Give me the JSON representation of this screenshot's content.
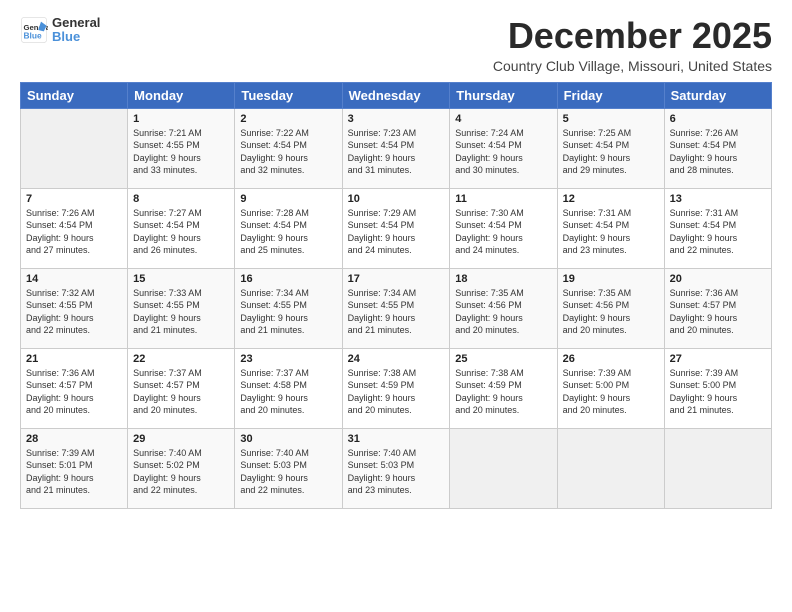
{
  "header": {
    "logo_line1": "General",
    "logo_line2": "Blue",
    "month": "December 2025",
    "location": "Country Club Village, Missouri, United States"
  },
  "weekdays": [
    "Sunday",
    "Monday",
    "Tuesday",
    "Wednesday",
    "Thursday",
    "Friday",
    "Saturday"
  ],
  "weeks": [
    [
      {
        "day": "",
        "info": ""
      },
      {
        "day": "1",
        "info": "Sunrise: 7:21 AM\nSunset: 4:55 PM\nDaylight: 9 hours\nand 33 minutes."
      },
      {
        "day": "2",
        "info": "Sunrise: 7:22 AM\nSunset: 4:54 PM\nDaylight: 9 hours\nand 32 minutes."
      },
      {
        "day": "3",
        "info": "Sunrise: 7:23 AM\nSunset: 4:54 PM\nDaylight: 9 hours\nand 31 minutes."
      },
      {
        "day": "4",
        "info": "Sunrise: 7:24 AM\nSunset: 4:54 PM\nDaylight: 9 hours\nand 30 minutes."
      },
      {
        "day": "5",
        "info": "Sunrise: 7:25 AM\nSunset: 4:54 PM\nDaylight: 9 hours\nand 29 minutes."
      },
      {
        "day": "6",
        "info": "Sunrise: 7:26 AM\nSunset: 4:54 PM\nDaylight: 9 hours\nand 28 minutes."
      }
    ],
    [
      {
        "day": "7",
        "info": "Sunrise: 7:26 AM\nSunset: 4:54 PM\nDaylight: 9 hours\nand 27 minutes."
      },
      {
        "day": "8",
        "info": "Sunrise: 7:27 AM\nSunset: 4:54 PM\nDaylight: 9 hours\nand 26 minutes."
      },
      {
        "day": "9",
        "info": "Sunrise: 7:28 AM\nSunset: 4:54 PM\nDaylight: 9 hours\nand 25 minutes."
      },
      {
        "day": "10",
        "info": "Sunrise: 7:29 AM\nSunset: 4:54 PM\nDaylight: 9 hours\nand 24 minutes."
      },
      {
        "day": "11",
        "info": "Sunrise: 7:30 AM\nSunset: 4:54 PM\nDaylight: 9 hours\nand 24 minutes."
      },
      {
        "day": "12",
        "info": "Sunrise: 7:31 AM\nSunset: 4:54 PM\nDaylight: 9 hours\nand 23 minutes."
      },
      {
        "day": "13",
        "info": "Sunrise: 7:31 AM\nSunset: 4:54 PM\nDaylight: 9 hours\nand 22 minutes."
      }
    ],
    [
      {
        "day": "14",
        "info": "Sunrise: 7:32 AM\nSunset: 4:55 PM\nDaylight: 9 hours\nand 22 minutes."
      },
      {
        "day": "15",
        "info": "Sunrise: 7:33 AM\nSunset: 4:55 PM\nDaylight: 9 hours\nand 21 minutes."
      },
      {
        "day": "16",
        "info": "Sunrise: 7:34 AM\nSunset: 4:55 PM\nDaylight: 9 hours\nand 21 minutes."
      },
      {
        "day": "17",
        "info": "Sunrise: 7:34 AM\nSunset: 4:55 PM\nDaylight: 9 hours\nand 21 minutes."
      },
      {
        "day": "18",
        "info": "Sunrise: 7:35 AM\nSunset: 4:56 PM\nDaylight: 9 hours\nand 20 minutes."
      },
      {
        "day": "19",
        "info": "Sunrise: 7:35 AM\nSunset: 4:56 PM\nDaylight: 9 hours\nand 20 minutes."
      },
      {
        "day": "20",
        "info": "Sunrise: 7:36 AM\nSunset: 4:57 PM\nDaylight: 9 hours\nand 20 minutes."
      }
    ],
    [
      {
        "day": "21",
        "info": "Sunrise: 7:36 AM\nSunset: 4:57 PM\nDaylight: 9 hours\nand 20 minutes."
      },
      {
        "day": "22",
        "info": "Sunrise: 7:37 AM\nSunset: 4:57 PM\nDaylight: 9 hours\nand 20 minutes."
      },
      {
        "day": "23",
        "info": "Sunrise: 7:37 AM\nSunset: 4:58 PM\nDaylight: 9 hours\nand 20 minutes."
      },
      {
        "day": "24",
        "info": "Sunrise: 7:38 AM\nSunset: 4:59 PM\nDaylight: 9 hours\nand 20 minutes."
      },
      {
        "day": "25",
        "info": "Sunrise: 7:38 AM\nSunset: 4:59 PM\nDaylight: 9 hours\nand 20 minutes."
      },
      {
        "day": "26",
        "info": "Sunrise: 7:39 AM\nSunset: 5:00 PM\nDaylight: 9 hours\nand 20 minutes."
      },
      {
        "day": "27",
        "info": "Sunrise: 7:39 AM\nSunset: 5:00 PM\nDaylight: 9 hours\nand 21 minutes."
      }
    ],
    [
      {
        "day": "28",
        "info": "Sunrise: 7:39 AM\nSunset: 5:01 PM\nDaylight: 9 hours\nand 21 minutes."
      },
      {
        "day": "29",
        "info": "Sunrise: 7:40 AM\nSunset: 5:02 PM\nDaylight: 9 hours\nand 22 minutes."
      },
      {
        "day": "30",
        "info": "Sunrise: 7:40 AM\nSunset: 5:03 PM\nDaylight: 9 hours\nand 22 minutes."
      },
      {
        "day": "31",
        "info": "Sunrise: 7:40 AM\nSunset: 5:03 PM\nDaylight: 9 hours\nand 23 minutes."
      },
      {
        "day": "",
        "info": ""
      },
      {
        "day": "",
        "info": ""
      },
      {
        "day": "",
        "info": ""
      }
    ]
  ]
}
